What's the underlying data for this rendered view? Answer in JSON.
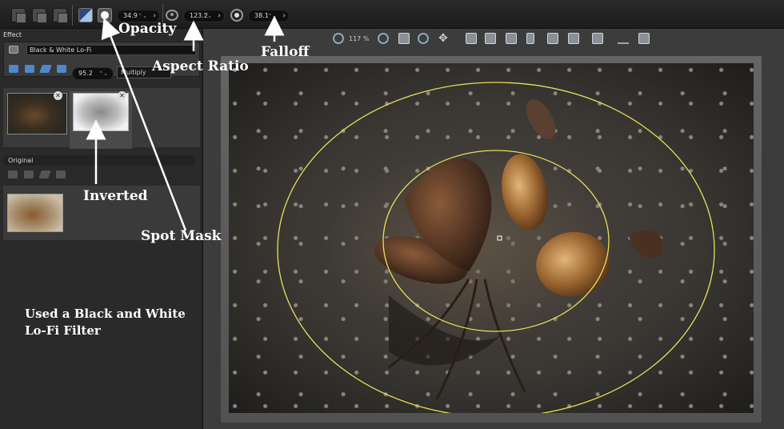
{
  "toolbar": {
    "opacity_value": "34.9",
    "aspect_ratio_value": "123.2",
    "falloff_value": "38.1"
  },
  "effect_panel": {
    "title": "Effect",
    "effect_name": "Black & White Lo-Fi",
    "layer_opacity": "95.2",
    "blend_mode": "Multiply",
    "original_label": "Original"
  },
  "viewer": {
    "zoom_level": "117 %"
  },
  "annotations": {
    "opacity": "Opacity",
    "aspect_ratio": "Aspect Ratio",
    "falloff": "Falloff",
    "inverted": "Inverted",
    "spot_mask": "Spot Mask",
    "note_line1": "Used a Black and White",
    "note_line2": "Lo-Fi Filter"
  },
  "colors": {
    "mask_ring": "#e6e05a",
    "annotation_text": "#ffffff",
    "toolbar_bg": "#1c1c1c",
    "panel_bg": "#2a2a2a"
  }
}
